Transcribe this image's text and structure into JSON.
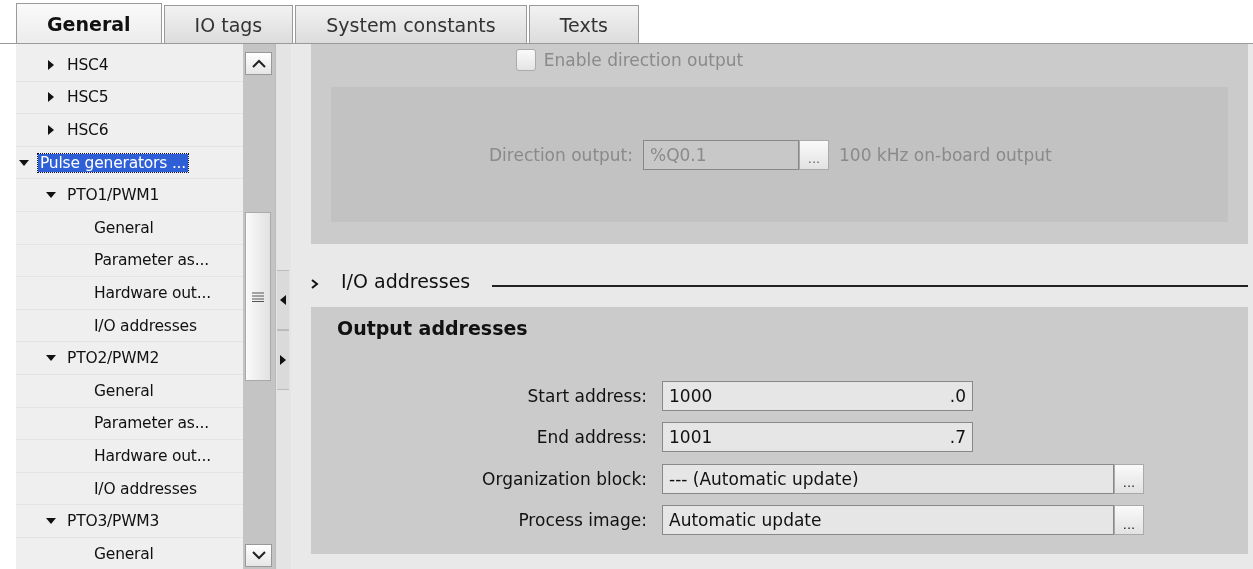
{
  "tabs": [
    {
      "label": "General",
      "selected": true
    },
    {
      "label": "IO tags",
      "selected": false
    },
    {
      "label": "System constants",
      "selected": false
    },
    {
      "label": "Texts",
      "selected": false
    }
  ],
  "tree": {
    "continued_items": [
      {
        "label": "HSC4",
        "expanded": false,
        "selected": false
      },
      {
        "label": "HSC5",
        "expanded": false,
        "selected": false
      },
      {
        "label": "HSC6",
        "expanded": false,
        "selected": false
      }
    ],
    "items": [
      {
        "label": "Pulse generators ...",
        "expanded": true,
        "selected": true,
        "children": [
          {
            "label": "PTO1/PWM1",
            "expanded": true,
            "selected": false,
            "children": [
              {
                "label": "General",
                "selected": false
              },
              {
                "label": "Parameter as...",
                "selected": false
              },
              {
                "label": "Hardware out...",
                "selected": false
              },
              {
                "label": "I/O addresses",
                "selected": false
              }
            ]
          },
          {
            "label": "PTO2/PWM2",
            "expanded": true,
            "selected": false,
            "children": [
              {
                "label": "General",
                "selected": false
              },
              {
                "label": "Parameter as...",
                "selected": false
              },
              {
                "label": "Hardware out...",
                "selected": false
              },
              {
                "label": "I/O addresses",
                "selected": false
              }
            ]
          },
          {
            "label": "PTO3/PWM3",
            "expanded": true,
            "selected": false,
            "children": [
              {
                "label": "General",
                "selected": false
              }
            ]
          }
        ]
      }
    ]
  },
  "direction_section": {
    "disabled": true,
    "checkbox": {
      "label": "Enable direction output",
      "checked": false
    },
    "field": {
      "label": "Direction output:",
      "value": "%Q0.1",
      "browse": "...",
      "note": "100 kHz on-board output"
    }
  },
  "io_section": {
    "title": "I/O addresses"
  },
  "output_addresses": {
    "title": "Output addresses",
    "fields": [
      {
        "kind": "address",
        "label": "Start address:",
        "value": "1000",
        "bit": ".0"
      },
      {
        "kind": "address",
        "label": "End address:",
        "value": "1001",
        "bit": ".7"
      },
      {
        "kind": "select",
        "label": "Organization block:",
        "value": "--- (Automatic update)",
        "browse": "..."
      },
      {
        "kind": "select",
        "label": "Process image:",
        "value": "Automatic update",
        "browse": "..."
      }
    ]
  }
}
